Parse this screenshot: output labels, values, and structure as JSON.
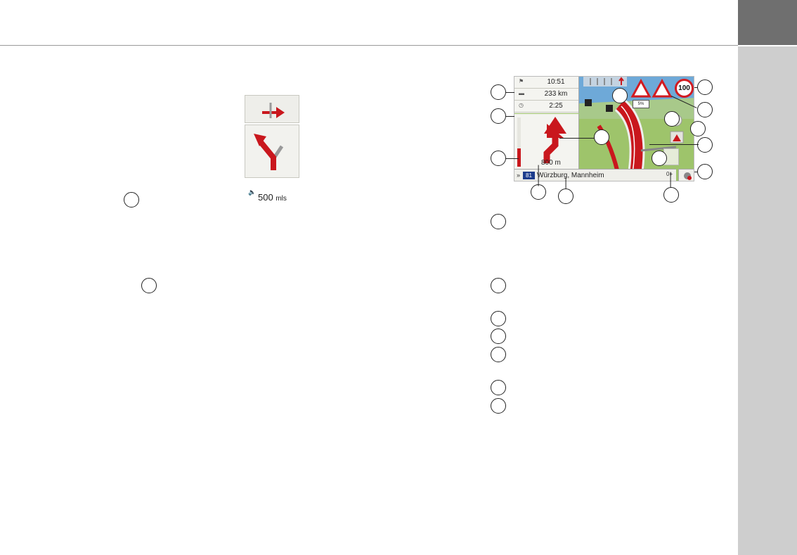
{
  "nav_screen": {
    "arrival_time": "10:51",
    "distance_remaining": "233 km",
    "travel_time": "2:25",
    "maneuver_distance": "800 m",
    "road_number": "81",
    "street_name": "Würzburg, Mannheim",
    "speed_limit": "100",
    "gradient": "5%",
    "street_arrows": "»",
    "street_right_icon": "0+"
  },
  "mini_display": {
    "distance_value": "500",
    "distance_unit": "mls"
  },
  "colors": {
    "route_red": "#c9171d",
    "map_green": "#9ec46b",
    "sky_blue": "#6ea9d8",
    "road_badge_blue": "#1c3c8c",
    "tab_dark": "#6f6f6f",
    "tab_light": "#cecece"
  },
  "icons": [
    "flag-icon",
    "distance-icon",
    "clock-icon",
    "speaker-icon",
    "fuel-icon",
    "parking-icon",
    "warning-sign-icon",
    "steep-gradient-sign-icon",
    "speed-limit-sign-icon",
    "zoom-icon",
    "traffic-icon",
    "satellite-icon",
    "mute-icon",
    "turn-arrow-icon"
  ]
}
